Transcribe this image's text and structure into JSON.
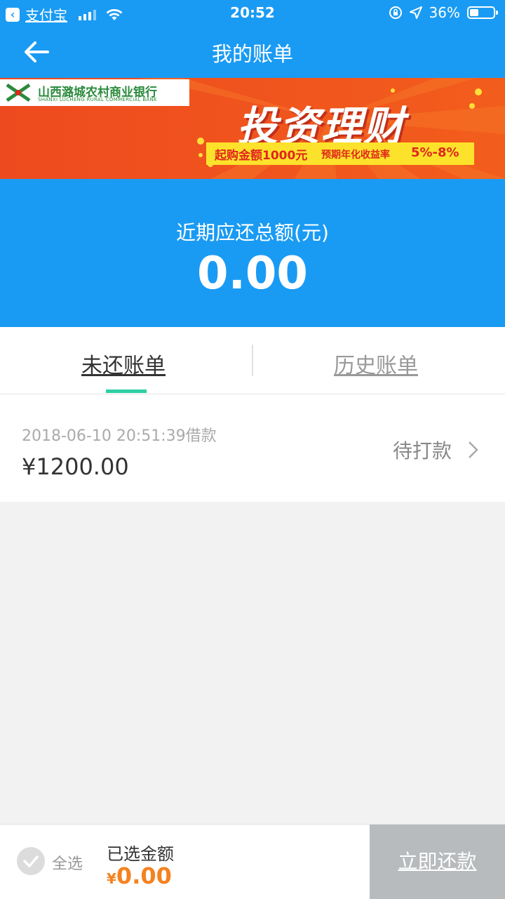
{
  "status_bar": {
    "app_name": "支付宝",
    "time": "20:52",
    "battery": "36%",
    "icons": [
      "back-app-icon",
      "signal-icon",
      "wifi-icon",
      "orientation-lock-icon",
      "location-icon",
      "battery-icon"
    ]
  },
  "nav": {
    "title": "我的账单",
    "back_icon": "back-arrow-icon"
  },
  "banner": {
    "bank_name": "山西潞城农村商业银行",
    "bank_name_en": "SHANXI LUCHENG RURAL COMMERCIAL BANK",
    "title": "投资理财",
    "strip_a": "起购金额1000元",
    "strip_b": "预期年化收益率",
    "strip_c": "5%-8%"
  },
  "summary": {
    "label": "近期应还总额(元)",
    "value": "0.00"
  },
  "tabs": {
    "unpaid": "未还账单",
    "history": "历史账单",
    "indicator_color": "#2fcfa6"
  },
  "bill": {
    "date": "2018-06-10 20:51:39借款",
    "amount": "¥1200.00",
    "status": "待打款"
  },
  "footer": {
    "select_all": "全选",
    "selected_label": "已选金额",
    "currency": "¥",
    "selected_amount": "0.00",
    "pay_button": "立即还款",
    "amount_color": "#f5821f"
  },
  "colors": {
    "primary": "#1a9bf3",
    "background": "#f2f2f2",
    "button_disabled": "#b8bbbd"
  }
}
